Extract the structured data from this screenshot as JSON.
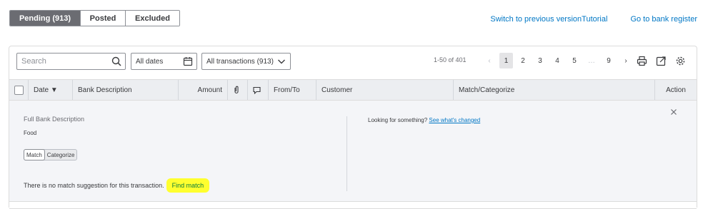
{
  "tabs": {
    "pending": "Pending (913)",
    "posted": "Posted",
    "excluded": "Excluded"
  },
  "links": {
    "switch_version": "Switch to previous versionTutorial",
    "bank_register": "Go to bank register"
  },
  "filters": {
    "search_placeholder": "Search",
    "dates": "All dates",
    "transactions": "All transactions (913)"
  },
  "pagination": {
    "range": "1-50 of 401",
    "prev": "‹",
    "pages": [
      "1",
      "2",
      "3",
      "4",
      "5",
      "…",
      "9"
    ],
    "next": "›",
    "current": "1"
  },
  "table": {
    "headers": {
      "date": "Date ▼",
      "bank_description": "Bank Description",
      "amount": "Amount",
      "from_to": "From/To",
      "customer": "Customer",
      "match_categorize": "Match/Categorize",
      "action": "Action"
    }
  },
  "expanded": {
    "full_desc_label": "Full Bank Description",
    "full_desc_value": "Food",
    "toggle_match": "Match",
    "toggle_categorize": "Categorize",
    "no_match_text": "There is no match suggestion for this transaction.",
    "find_match": "Find match",
    "looking_text": "Looking for something?",
    "whats_changed": "See what's changed"
  },
  "colors": {
    "accent": "#0077c5",
    "highlight": "#ffff2f",
    "find_match_text": "#0a7d3b",
    "active_tab": "#6b6c72"
  }
}
